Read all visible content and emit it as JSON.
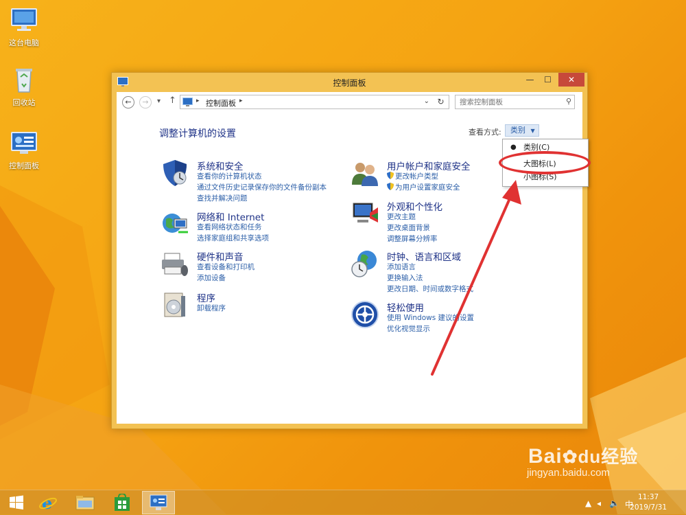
{
  "desktop": {
    "icons": [
      {
        "label": "这台电脑"
      },
      {
        "label": "回收站"
      },
      {
        "label": "控制面板"
      }
    ]
  },
  "window": {
    "title": "控制面板",
    "controls": {
      "minimize": "—",
      "maximize": "☐",
      "close": "✕"
    }
  },
  "navbar": {
    "breadcrumb": "控制面板",
    "search_placeholder": "搜索控制面板"
  },
  "content": {
    "heading": "调整计算机的设置",
    "view_by_label": "查看方式:",
    "view_by_value": "类别",
    "categories": [
      {
        "title": "系统和安全",
        "links": [
          "查看你的计算机状态",
          "通过文件历史记录保存你的文件备份副本",
          "查找并解决问题"
        ]
      },
      {
        "title": "网络和 Internet",
        "links": [
          "查看网络状态和任务",
          "选择家庭组和共享选项"
        ]
      },
      {
        "title": "硬件和声音",
        "links": [
          "查看设备和打印机",
          "添加设备"
        ]
      },
      {
        "title": "程序",
        "links": [
          "卸载程序"
        ]
      },
      {
        "title": "用户帐户和家庭安全",
        "links": [
          "更改帐户类型",
          "为用户设置家庭安全"
        ]
      },
      {
        "title": "外观和个性化",
        "links": [
          "更改主题",
          "更改桌面背景",
          "调整屏幕分辨率"
        ]
      },
      {
        "title": "时钟、语言和区域",
        "links": [
          "添加语言",
          "更换输入法",
          "更改日期、时间或数字格式"
        ]
      },
      {
        "title": "轻松使用",
        "links": [
          "使用 Windows 建议的设置",
          "优化视觉显示"
        ]
      }
    ]
  },
  "view_menu": {
    "items": [
      {
        "label": "类别(C)",
        "selected": true
      },
      {
        "label": "大图标(L)",
        "selected": false
      },
      {
        "label": "小图标(S)",
        "selected": false
      }
    ],
    "highlight_color": "#e03232"
  },
  "taskbar": {
    "ime": "中",
    "time": "11:37",
    "date": "2019/7/31"
  },
  "watermark": {
    "brand": "Bai",
    "brand_cn": "经验",
    "url": "jingyan.baidu.com"
  },
  "colors": {
    "desktop": "#f5a312",
    "window_frame": "#f3c253",
    "link": "#2c5fa8",
    "heading": "#1e3287",
    "close_button": "#c7493a"
  }
}
